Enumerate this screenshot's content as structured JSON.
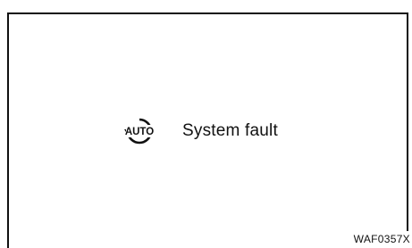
{
  "display": {
    "message": "System fault",
    "icon_name": "auto-stop-start-icon",
    "icon_text": "AUTO"
  },
  "figure_code": "WAF0357X"
}
